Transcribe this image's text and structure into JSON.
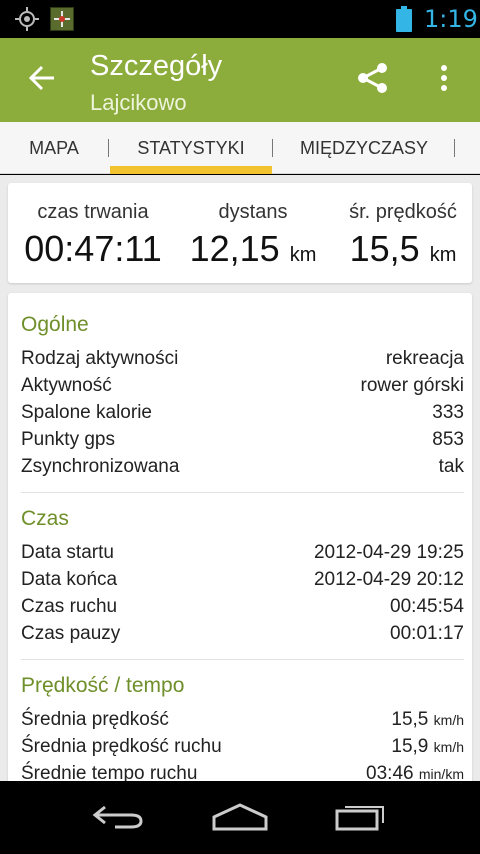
{
  "status_bar": {
    "time": "1:19",
    "icons": [
      "gps-icon",
      "app-notification-icon",
      "battery-icon"
    ],
    "time_color": "#33b5e5"
  },
  "action_bar": {
    "title": "Szczegóły",
    "subtitle": "Lajcikowo",
    "background": "#8cac3b",
    "icons": [
      "back-arrow-icon",
      "share-icon",
      "overflow-menu-icon"
    ]
  },
  "tabs": {
    "items": [
      {
        "label": "MAPA"
      },
      {
        "label": "STATYSTYKI",
        "active": true
      },
      {
        "label": "MIĘDZYCZASY"
      }
    ],
    "indicator_color": "#f1c32e"
  },
  "summary": {
    "duration_label": "czas trwania",
    "duration_value": "00:47:11",
    "distance_label": "dystans",
    "distance_value": "12,15",
    "distance_unit": "km",
    "speed_label": "śr. prędkość",
    "speed_value": "15,5",
    "speed_unit": "km"
  },
  "sections": {
    "general": {
      "title": "Ogólne",
      "rows": [
        {
          "label": "Rodzaj aktywności",
          "value": "rekreacja"
        },
        {
          "label": "Aktywność",
          "value": "rower górski"
        },
        {
          "label": "Spalone kalorie",
          "value": "333"
        },
        {
          "label": "Punkty gps",
          "value": "853"
        },
        {
          "label": "Zsynchronizowana",
          "value": "tak"
        }
      ]
    },
    "time": {
      "title": "Czas",
      "rows": [
        {
          "label": "Data startu",
          "value": "2012-04-29 19:25"
        },
        {
          "label": "Data końca",
          "value": "2012-04-29 20:12"
        },
        {
          "label": "Czas ruchu",
          "value": "00:45:54"
        },
        {
          "label": "Czas pauzy",
          "value": "00:01:17"
        }
      ]
    },
    "speed": {
      "title": "Prędkość / tempo",
      "rows": [
        {
          "label": "Średnia prędkość",
          "value": "15,5",
          "unit": "km/h"
        },
        {
          "label": "Średnia prędkość ruchu",
          "value": "15,9",
          "unit": "km/h"
        },
        {
          "label": "Średnie tempo ruchu",
          "value": "03:46",
          "unit": "min/km"
        }
      ]
    }
  },
  "nav_bar": {
    "icons": [
      "nav-back-icon",
      "nav-home-icon",
      "nav-recent-apps-icon"
    ]
  },
  "colors": {
    "accent_green": "#8cac3b",
    "section_title": "#6f8f2a",
    "tab_indicator": "#f1c32e"
  }
}
